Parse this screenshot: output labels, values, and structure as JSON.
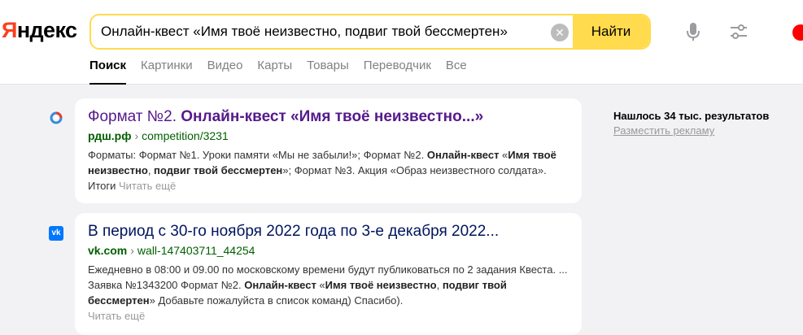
{
  "header": {
    "logo": {
      "first": "Я",
      "rest": "ндекс"
    },
    "search": {
      "query": "Онлайн-квест «Имя твоё неизвестно, подвиг твой бессмертен»",
      "clear_symbol": "✕",
      "find_label": "Найти"
    }
  },
  "nav": {
    "tabs": [
      {
        "label": "Поиск",
        "active": true
      },
      {
        "label": "Картинки"
      },
      {
        "label": "Видео"
      },
      {
        "label": "Карты"
      },
      {
        "label": "Товары"
      },
      {
        "label": "Переводчик"
      },
      {
        "label": "Все"
      }
    ]
  },
  "results": [
    {
      "title_plain": "Формат №2. ",
      "title_bold": "Онлайн-квест «Имя твоё неизвестно...»",
      "domain": "рдш.рф",
      "path": "competition/3231",
      "snippet": {
        "t1": "Форматы: Формат №1. Уроки памяти «Мы не забыли!»; Формат №2. ",
        "b1": "Онлайн-квест",
        "t2": " «",
        "b2": "Имя твоё неизвестно",
        "t3": ", ",
        "b3": "подвиг твой бессмертен",
        "t4": "»; Формат №3. Акция «Образ неизвестного солдата». Итоги "
      },
      "read_more": "Читать ещё"
    },
    {
      "title": "В период с 30-го ноября 2022 года по 3-е декабря 2022...",
      "domain": "vk.com",
      "path": "wall-147403711_44254",
      "snippet": {
        "t1": "Ежедневно в 08:00 и 09.00 по московскому времени будут публиковаться по 2 задания Квеста. ... Заявка №1343200 Формат №2. ",
        "b1": "Онлайн-квест",
        "t2": " «",
        "b2": "Имя твоё неизвестно",
        "t3": ", ",
        "b3": "подвиг твой бессмертен",
        "t4": "» Добавьте пожалуйста в список команд) Спасибо)."
      },
      "read_more": "Читать ещё",
      "favicon_text": "vk"
    }
  ],
  "sidebar": {
    "found": "Нашлось 34 тыс. результатов",
    "ad_link": "Разместить рекламу"
  },
  "colors": {
    "accent": "#ffdb4d",
    "brand": "#fc3f1d",
    "visited": "#551a8b",
    "link": "#00155d",
    "url_green": "#006000"
  }
}
